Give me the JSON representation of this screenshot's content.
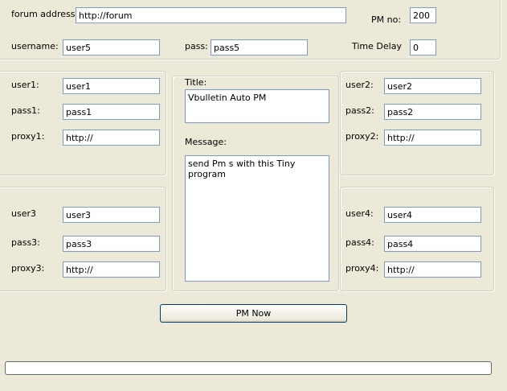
{
  "top": {
    "forum_address_label": "forum address",
    "forum_address_value": "http://forum",
    "pm_no_label": "PM no:",
    "pm_no_value": "200",
    "username_label": "username:",
    "username_value": "user5",
    "pass_label": "pass:",
    "pass_value": "pass5",
    "time_delay_label": "Time Delay",
    "time_delay_value": "0"
  },
  "accounts": [
    {
      "user_label": "user1:",
      "user": "user1",
      "pass_label": "pass1:",
      "pass": "pass1",
      "proxy_label": "proxy1:",
      "proxy": "http://"
    },
    {
      "user_label": "user2:",
      "user": "user2",
      "pass_label": "pass2:",
      "pass": "pass2",
      "proxy_label": "proxy2:",
      "proxy": "http://"
    },
    {
      "user_label": "user3",
      "user": "user3",
      "pass_label": "pass3:",
      "pass": "pass3",
      "proxy_label": "proxy3:",
      "proxy": "http://"
    },
    {
      "user_label": "user4:",
      "user": "user4",
      "pass_label": "pass4:",
      "pass": "pass4",
      "proxy_label": "proxy4:",
      "proxy": "http://"
    }
  ],
  "message": {
    "title_label": "Title:",
    "title_value": "Vbulletin Auto PM",
    "message_label": "Message:",
    "message_value": "send Pm s with this Tiny program"
  },
  "actions": {
    "pm_now_label": "PM Now"
  },
  "progress": {
    "value": 0
  },
  "colors": {
    "window_bg": "#ece9d8",
    "input_border": "#7f9db9",
    "group_border": "#d0d0bf"
  }
}
